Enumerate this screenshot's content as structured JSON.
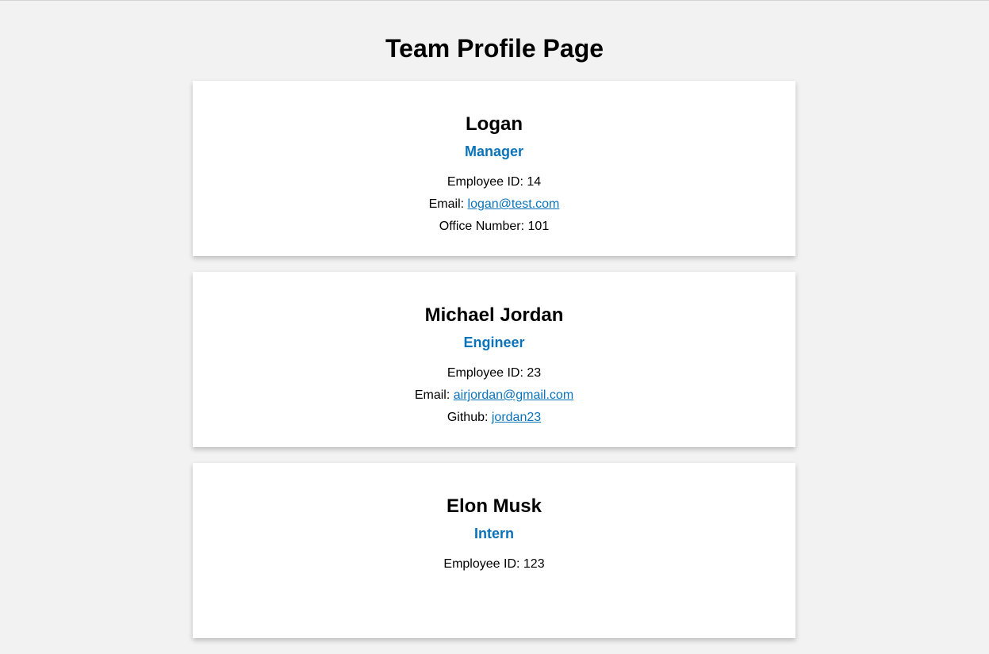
{
  "page": {
    "title": "Team Profile Page"
  },
  "colors": {
    "background": "#f2f2f2",
    "card": "#ffffff",
    "accent": "#0a73ba"
  },
  "team": [
    {
      "name": "Logan",
      "role": "Manager",
      "id_label": "Employee ID: ",
      "id": "14",
      "email_label": "Email: ",
      "email": "logan@test.com",
      "extra_label": "Office Number: ",
      "extra": "101"
    },
    {
      "name": "Michael Jordan",
      "role": "Engineer",
      "id_label": "Employee ID: ",
      "id": "23",
      "email_label": "Email: ",
      "email": "airjordan@gmail.com",
      "extra_label": "Github: ",
      "extra": "jordan23"
    },
    {
      "name": "Elon Musk",
      "role": "Intern",
      "id_label": "Employee ID: ",
      "id": "123"
    }
  ]
}
